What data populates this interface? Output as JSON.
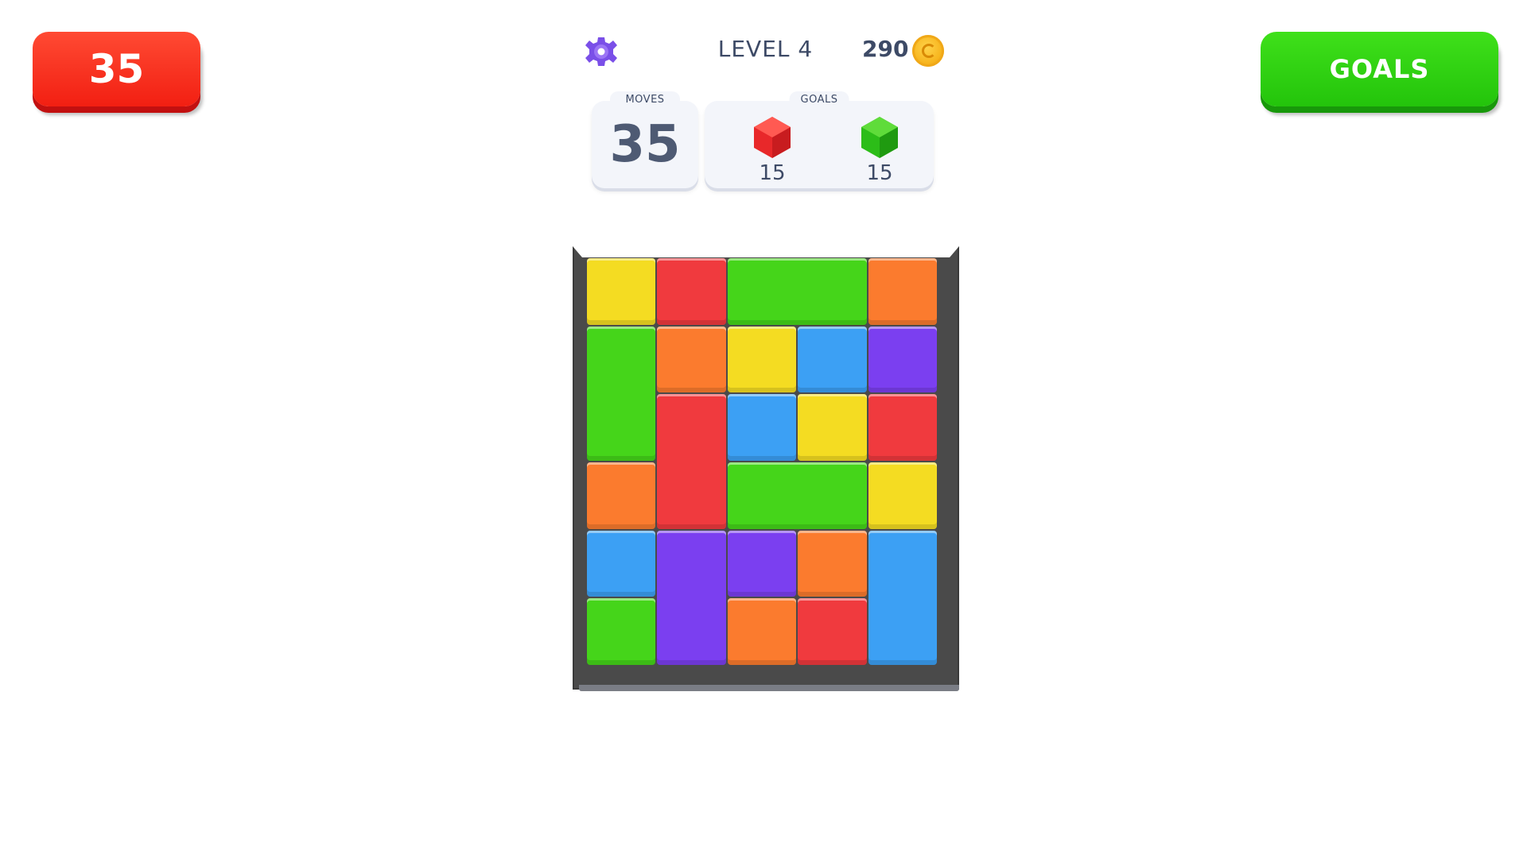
{
  "hud": {
    "moves_button_label": "35",
    "goals_button_label": "GOALS",
    "level_label": "LEVEL 4",
    "coins": "290",
    "settings_icon": "gear-icon",
    "coin_icon": "coin-icon"
  },
  "moves_card": {
    "title": "MOVES",
    "value": "35"
  },
  "goals_card": {
    "title": "GOALS",
    "items": [
      {
        "icon": "red-hexagon-icon",
        "color": "#e8282a",
        "count": "15"
      },
      {
        "icon": "green-hexagon-icon",
        "color": "#2cbd18",
        "count": "15"
      }
    ]
  },
  "colors": {
    "yellow": "#f4dc22",
    "red": "#f03a3e",
    "green": "#45d51a",
    "orange": "#fb7b2e",
    "blue": "#3ca0f4",
    "purple": "#7b3ff0"
  },
  "board": {
    "columns": 5,
    "rows": 6,
    "tiles": [
      {
        "color": "yellow",
        "col": 0,
        "row": 0,
        "w": 1,
        "h": 1
      },
      {
        "color": "red",
        "col": 1,
        "row": 0,
        "w": 1,
        "h": 1
      },
      {
        "color": "green",
        "col": 2,
        "row": 0,
        "w": 2,
        "h": 1
      },
      {
        "color": "orange",
        "col": 4,
        "row": 0,
        "w": 1,
        "h": 1
      },
      {
        "color": "green",
        "col": 0,
        "row": 1,
        "w": 1,
        "h": 2
      },
      {
        "color": "orange",
        "col": 1,
        "row": 1,
        "w": 1,
        "h": 1
      },
      {
        "color": "yellow",
        "col": 2,
        "row": 1,
        "w": 1,
        "h": 1
      },
      {
        "color": "blue",
        "col": 3,
        "row": 1,
        "w": 1,
        "h": 1
      },
      {
        "color": "purple",
        "col": 4,
        "row": 1,
        "w": 1,
        "h": 1
      },
      {
        "color": "red",
        "col": 1,
        "row": 2,
        "w": 1,
        "h": 2
      },
      {
        "color": "blue",
        "col": 2,
        "row": 2,
        "w": 1,
        "h": 1
      },
      {
        "color": "yellow",
        "col": 3,
        "row": 2,
        "w": 1,
        "h": 1
      },
      {
        "color": "red",
        "col": 4,
        "row": 2,
        "w": 1,
        "h": 1
      },
      {
        "color": "orange",
        "col": 0,
        "row": 3,
        "w": 1,
        "h": 1
      },
      {
        "color": "green",
        "col": 2,
        "row": 3,
        "w": 2,
        "h": 1
      },
      {
        "color": "yellow",
        "col": 4,
        "row": 3,
        "w": 1,
        "h": 1
      },
      {
        "color": "blue",
        "col": 0,
        "row": 4,
        "w": 1,
        "h": 1
      },
      {
        "color": "purple",
        "col": 1,
        "row": 4,
        "w": 1,
        "h": 2
      },
      {
        "color": "purple",
        "col": 2,
        "row": 4,
        "w": 1,
        "h": 1
      },
      {
        "color": "orange",
        "col": 3,
        "row": 4,
        "w": 1,
        "h": 1
      },
      {
        "color": "blue",
        "col": 4,
        "row": 4,
        "w": 1,
        "h": 2
      },
      {
        "color": "green",
        "col": 0,
        "row": 5,
        "w": 1,
        "h": 1
      },
      {
        "color": "orange",
        "col": 2,
        "row": 5,
        "w": 1,
        "h": 1
      },
      {
        "color": "red",
        "col": 3,
        "row": 5,
        "w": 1,
        "h": 1
      }
    ]
  }
}
